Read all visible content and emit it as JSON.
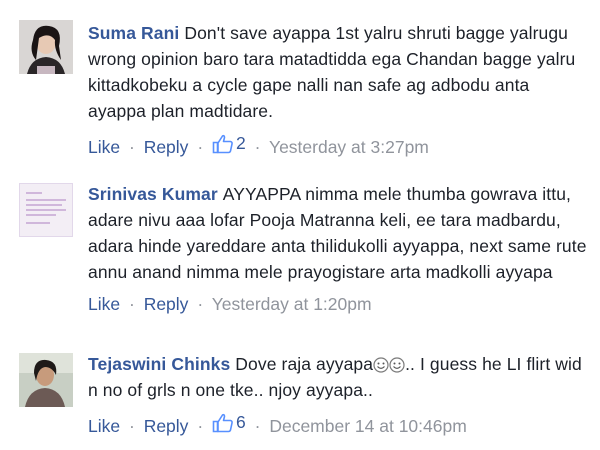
{
  "comments": [
    {
      "author": "Suma Rani",
      "text": "Don't save ayappa 1st yalru shruti bagge yalrugu wrong opinion baro tara matadtidda ega Chandan bagge yalru kittadkobeku a cycle gape nalli nan safe ag adbodu anta ayappa plan madtidare.",
      "like_label": "Like",
      "reply_label": "Reply",
      "like_count": "2",
      "timestamp": "Yesterday at 3:27pm",
      "avatar_icon": "profile-photo-woman"
    },
    {
      "author": "Srinivas Kumar",
      "text": "AYYAPPA nimma mele thumba gowrava ittu, adare nivu aaa lofar Pooja Matranna keli, ee tara madbardu, adara hinde yareddare anta thilidukolli ayyappa, next same rute annu anand nimma mele prayogistare arta madkolli ayyapa",
      "like_label": "Like",
      "reply_label": "Reply",
      "timestamp": "Yesterday at 1:20pm",
      "avatar_icon": "profile-text-image"
    },
    {
      "author": "Tejaswini Chinks",
      "text_before": "Dove raja ayyapa",
      "text_after": ".. I guess he LI flirt wid n no of grls n one tke.. njoy ayyapa..",
      "like_label": "Like",
      "reply_label": "Reply",
      "like_count": "6",
      "timestamp": "December 14 at 10:46pm",
      "avatar_icon": "profile-photo-woman"
    }
  ],
  "separator": "·",
  "colors": {
    "link": "#365899",
    "meta": "#90949c",
    "text": "#1d2129"
  }
}
